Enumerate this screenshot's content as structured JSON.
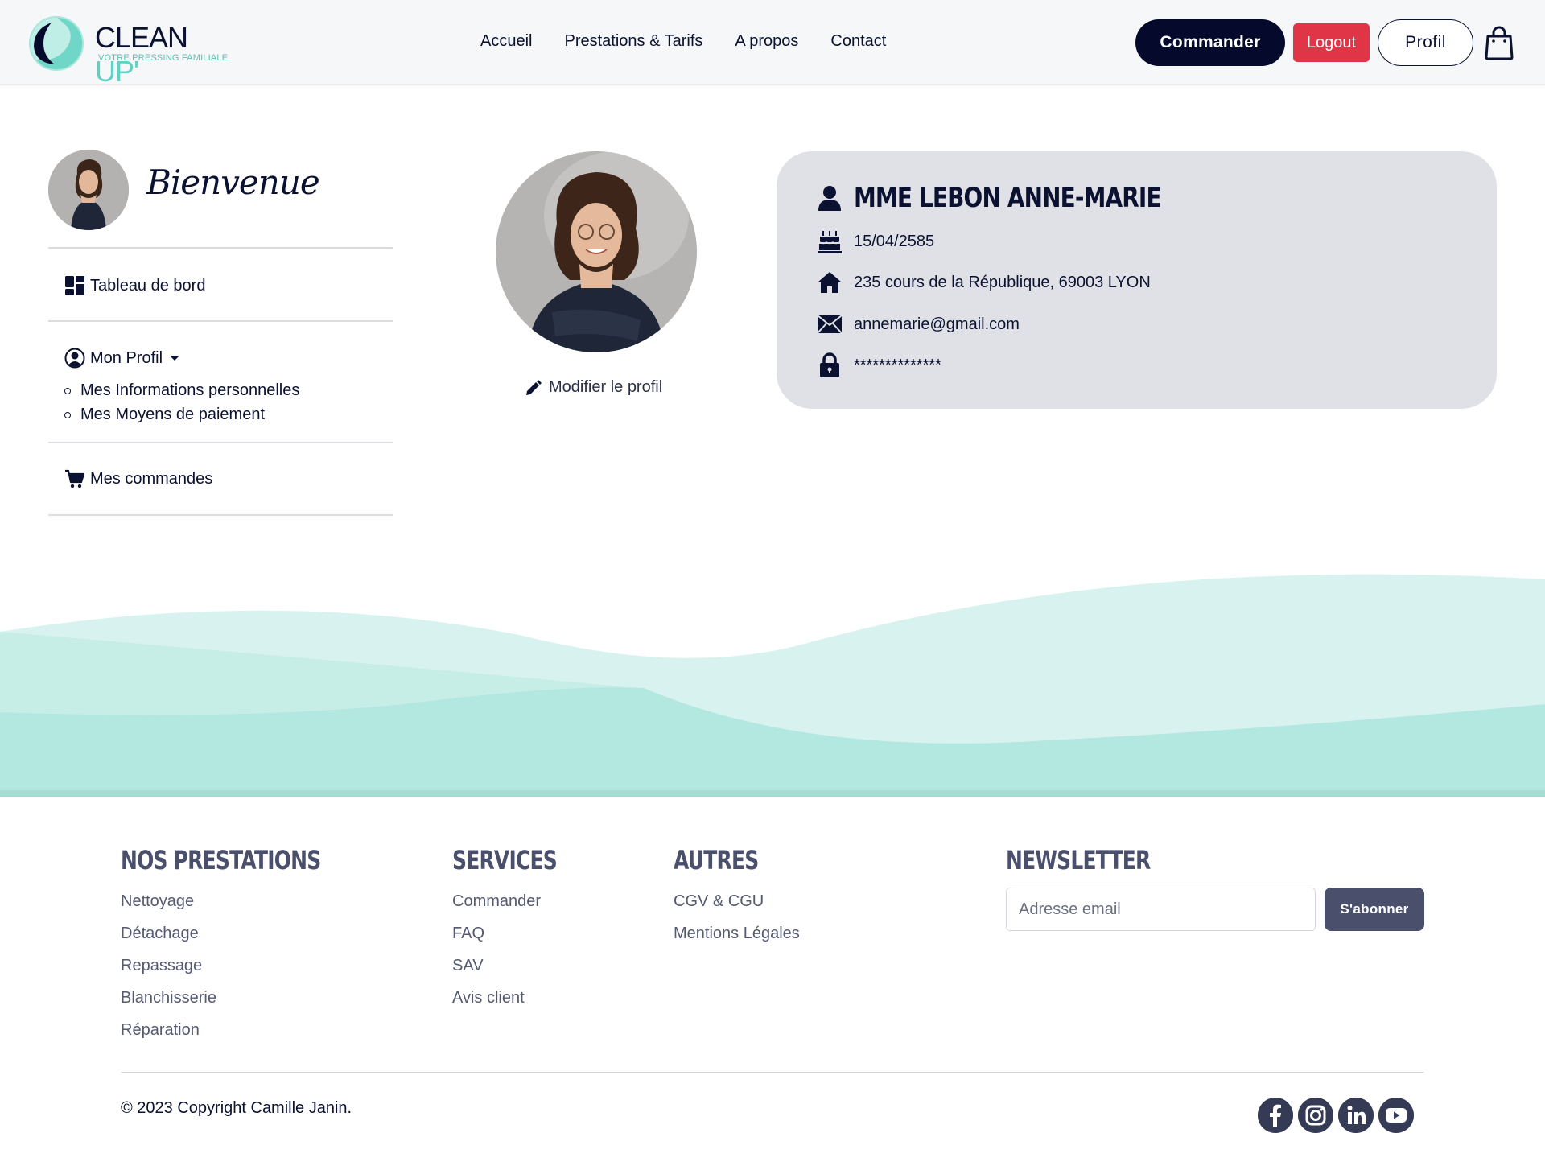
{
  "brand": {
    "name_main": "CLEAN",
    "name_accent": "UP'",
    "tagline": "VOTRE PRESSING FAMILIALE",
    "colors": {
      "navy": "#050a2c",
      "mint": "#5fd0c2",
      "red": "#e03546",
      "card_bg": "#e0e1e6",
      "footer_heading": "#4a4f6c"
    }
  },
  "nav": {
    "items": [
      {
        "label": "Accueil"
      },
      {
        "label": "Prestations & Tarifs"
      },
      {
        "label": "A propos"
      },
      {
        "label": "Contact"
      }
    ],
    "commander_label": "Commander",
    "logout_label": "Logout",
    "profil_label": "Profil",
    "cart_icon": "shopping-bag-icon"
  },
  "sidebar": {
    "welcome": "Bienvenue",
    "dashboard_label": "Tableau de bord",
    "profile_label": "Mon Profil",
    "profile_sub": [
      {
        "label": "Mes Informations personnelles"
      },
      {
        "label": "Mes Moyens de paiement"
      }
    ],
    "orders_label": "Mes commandes"
  },
  "profile": {
    "edit_label": "Modifier le profil"
  },
  "info": {
    "name": "MME LEBON ANNE-MARIE",
    "birthdate": "15/04/2585",
    "address": "235 cours de la République, 69003 LYON",
    "email": "annemarie@gmail.com",
    "password": "**************"
  },
  "footer": {
    "prestations": {
      "title": "NOS PRESTATIONS",
      "items": [
        "Nettoyage",
        "Détachage",
        "Repassage",
        "Blanchisserie",
        "Réparation"
      ]
    },
    "services": {
      "title": "SERVICES",
      "items": [
        "Commander",
        "FAQ",
        "SAV",
        "Avis client"
      ]
    },
    "autres": {
      "title": "AUTRES",
      "items": [
        "CGV & CGU",
        "Mentions Légales"
      ]
    },
    "newsletter": {
      "title": "NEWSLETTER",
      "placeholder": "Adresse email",
      "button_label": "S'abonner"
    },
    "copyright": "© 2023 Copyright Camille Janin.",
    "socials": [
      "facebook-icon",
      "instagram-icon",
      "linkedin-icon",
      "youtube-icon"
    ]
  }
}
